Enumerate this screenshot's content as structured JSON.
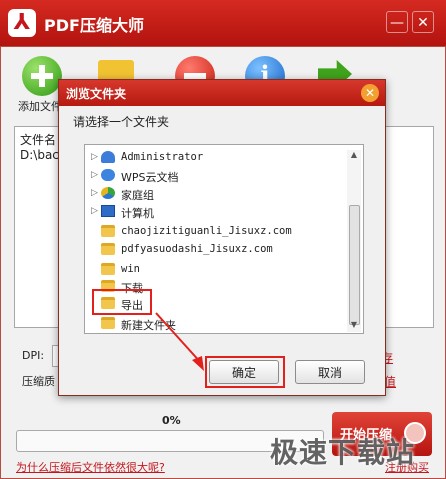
{
  "app": {
    "title": "PDF压缩大师",
    "logo_glyph": "⅄",
    "minimize": "—",
    "close": "✕"
  },
  "toolbar": {
    "add_label": "添加文件"
  },
  "file_list": {
    "col_name": "文件名",
    "col_right": "式",
    "row_path": "D:\\back"
  },
  "settings": {
    "dpi_label": "DPI:",
    "quality_label": "压缩质",
    "link1": "存",
    "link2": "认值"
  },
  "progress": {
    "percent_text": "0%",
    "fraction": 0
  },
  "start_button": {
    "label": "开始压缩"
  },
  "footer": {
    "help_link": "为什么压缩后文件依然很大呢?",
    "register_link": "注册购买"
  },
  "watermark": "极速下载站",
  "dialog": {
    "title": "浏览文件夹",
    "close": "✕",
    "prompt": "请选择一个文件夹",
    "tree": [
      {
        "label": "Administrator",
        "icon": "user-icon",
        "arrow": "▷"
      },
      {
        "label": "WPS云文档",
        "icon": "cloud-icon",
        "arrow": "▷"
      },
      {
        "label": "家庭组",
        "icon": "homegroup-icon",
        "arrow": "▷"
      },
      {
        "label": "计算机",
        "icon": "computer-icon",
        "arrow": "▷"
      },
      {
        "label": "chaojizitiguanli_Jisuxz.com",
        "icon": "folder-icon",
        "arrow": ""
      },
      {
        "label": "pdfyasuodashi_Jisuxz.com",
        "icon": "folder-icon",
        "arrow": ""
      },
      {
        "label": "win",
        "icon": "folder-icon",
        "arrow": ""
      },
      {
        "label": "下载",
        "icon": "folder-icon",
        "arrow": ""
      },
      {
        "label": "导出",
        "icon": "folder-icon",
        "arrow": ""
      },
      {
        "label": "新建文件夹",
        "icon": "folder-icon",
        "arrow": ""
      }
    ],
    "ok": "确定",
    "cancel": "取消"
  },
  "colors": {
    "brand_red": "#c4161c",
    "highlight_red": "#e2201c"
  }
}
